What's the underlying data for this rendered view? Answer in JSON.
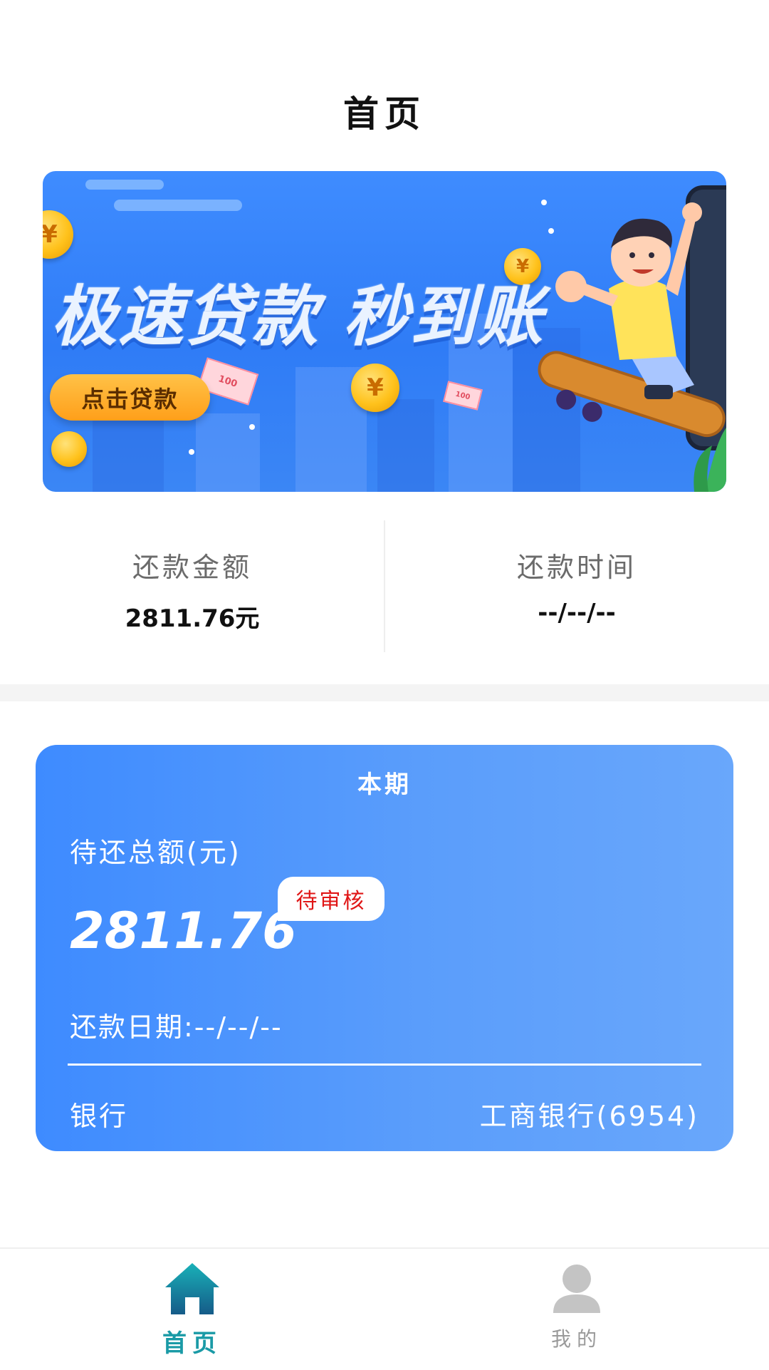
{
  "header": {
    "title": "首页"
  },
  "banner": {
    "slogan": "极速贷款 秒到账",
    "cta_label": "点击贷款",
    "coin_symbol": "¥",
    "bill_label": "100"
  },
  "summary": {
    "repay_amount_label": "还款金额",
    "repay_amount_value": "2811.76元",
    "repay_time_label": "还款时间",
    "repay_time_value": "--/--/--"
  },
  "card": {
    "title": "本期",
    "pending_total_label": "待还总额(元)",
    "pending_total_value": "2811.76",
    "status_badge": "待审核",
    "repay_date": "还款日期:--/--/--",
    "bank_label": "银行",
    "bank_value": "工商银行(6954)"
  },
  "bottom_nav": {
    "items": [
      {
        "label": "首页",
        "icon": "home-icon",
        "active": true
      },
      {
        "label": "我的",
        "icon": "user-icon",
        "active": false
      }
    ]
  },
  "colors": {
    "accent": "#1a9aa6",
    "card_blue": "#4a93fc",
    "status_red": "#e01616",
    "cta_orange": "#ffa826"
  }
}
